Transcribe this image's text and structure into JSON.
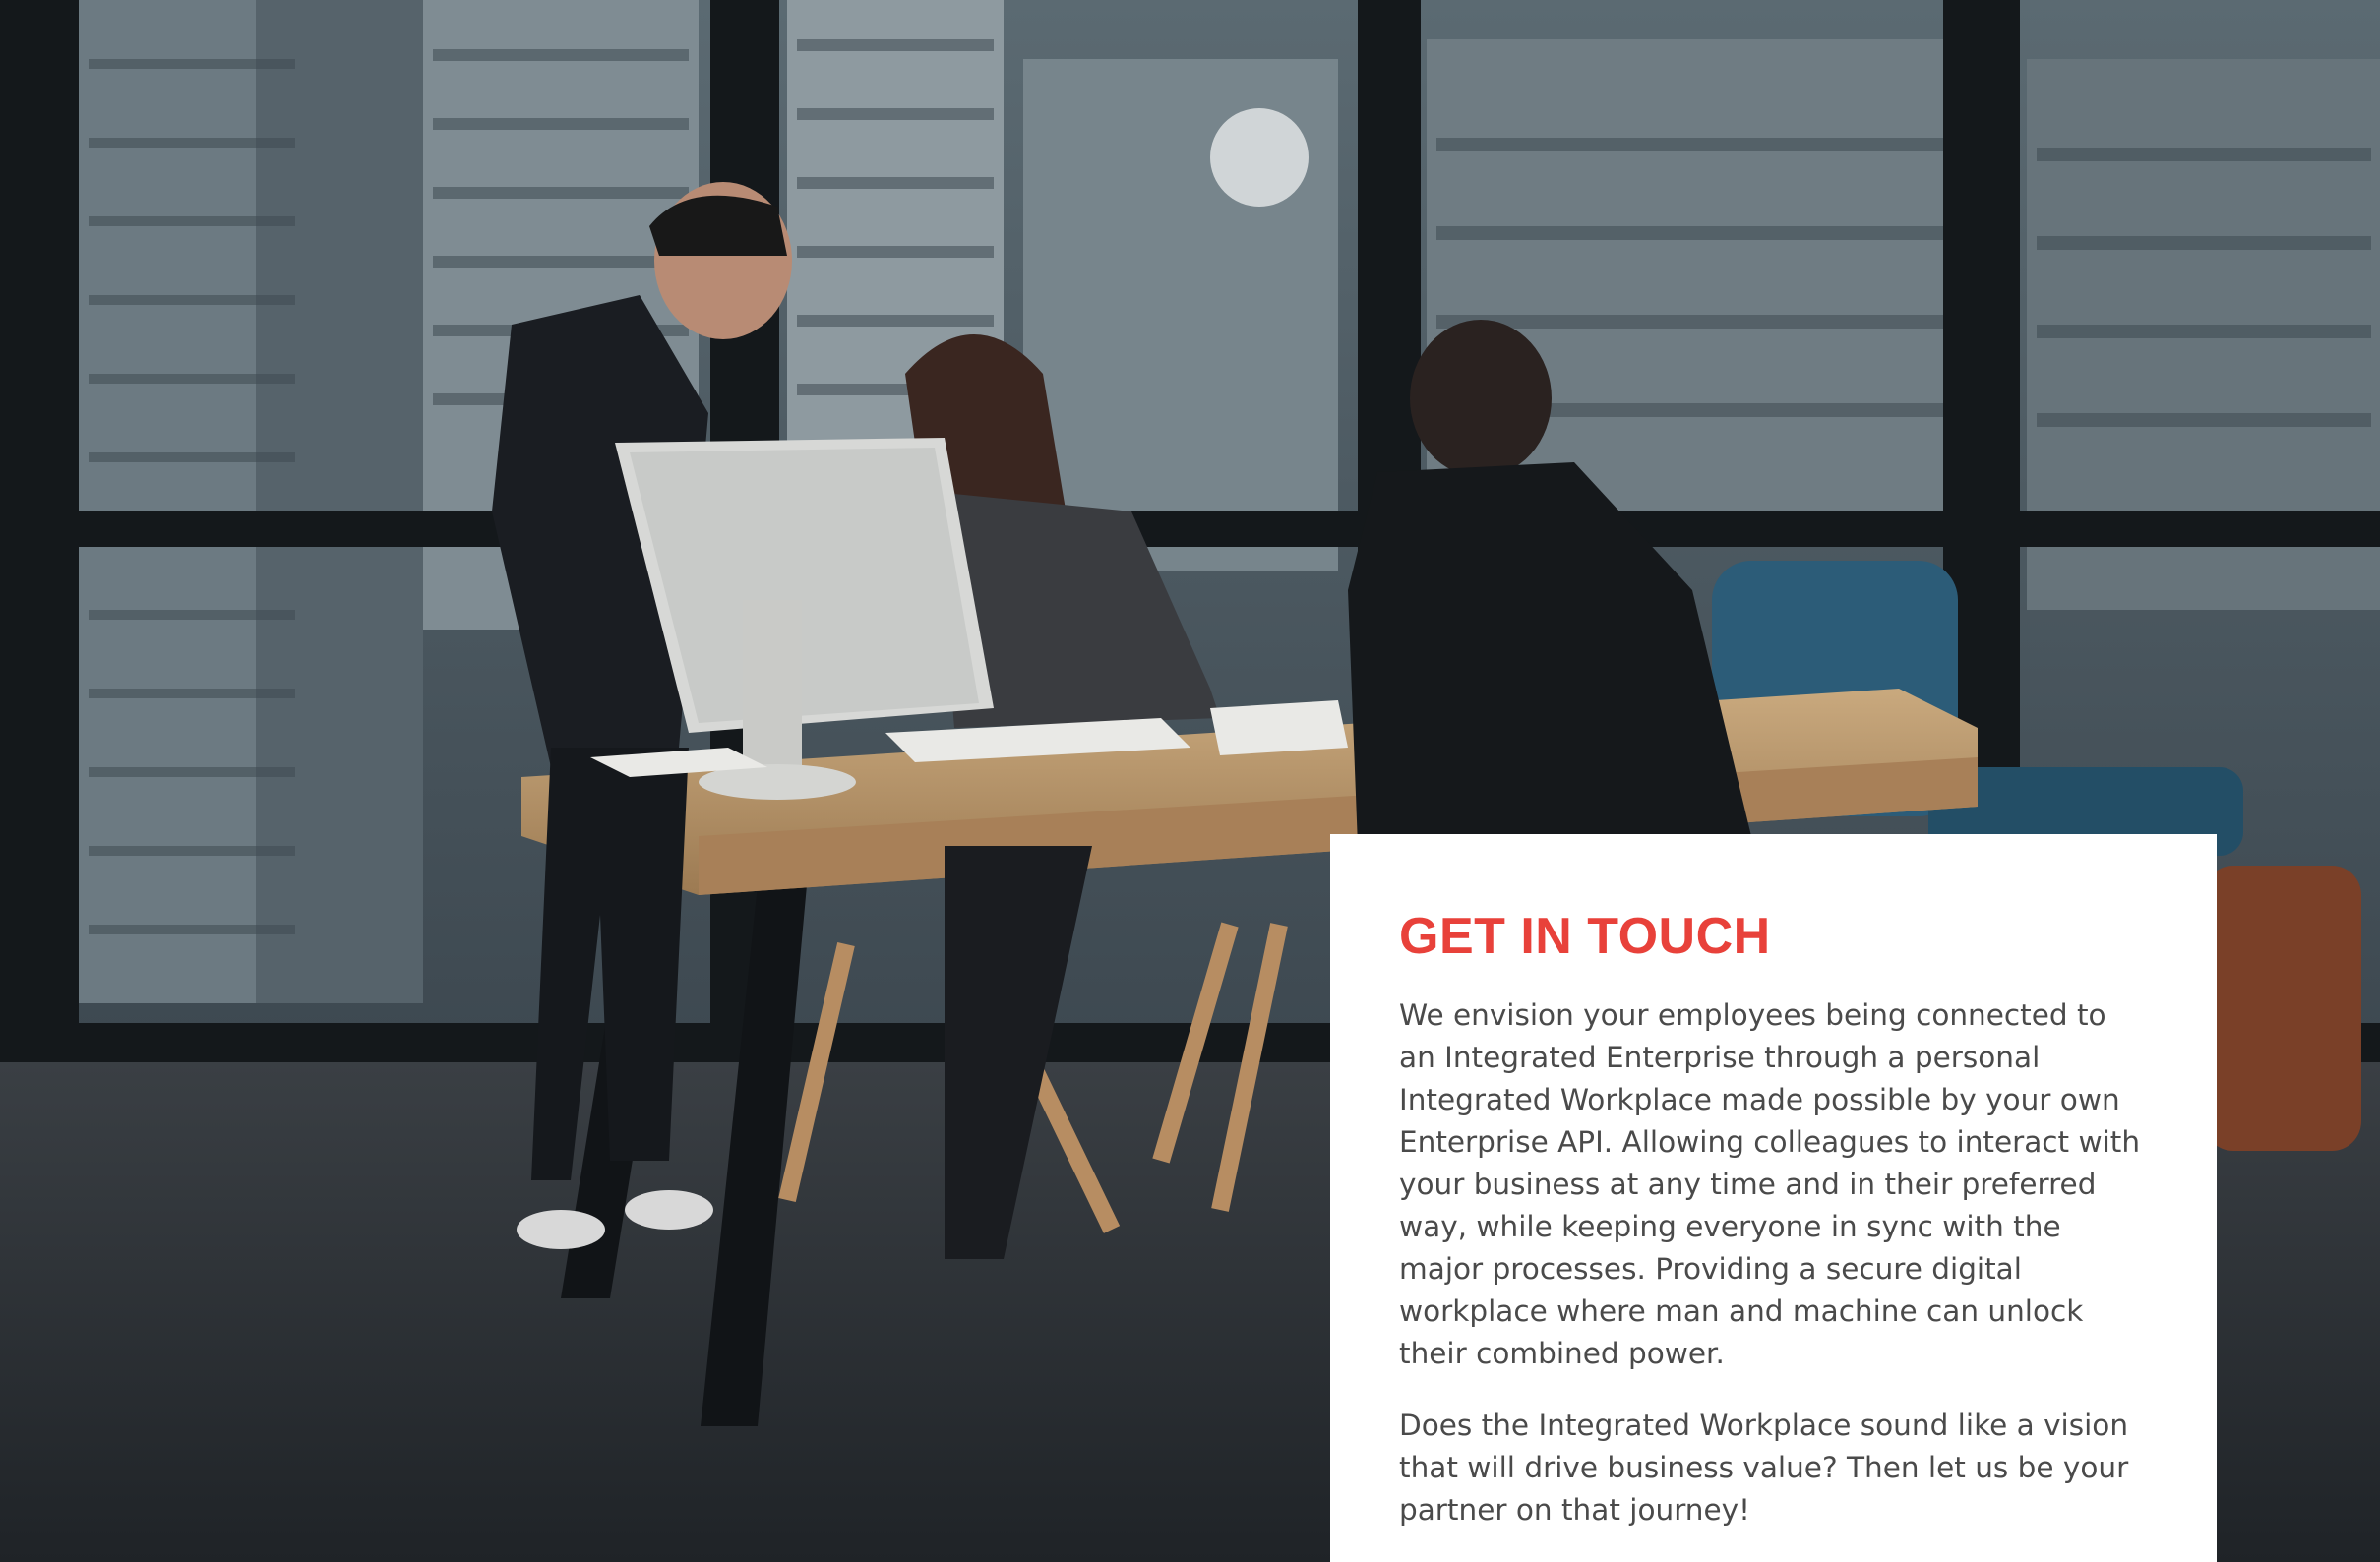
{
  "colors": {
    "accent": "#e8413a",
    "body_text": "#4a4a4a",
    "card_background": "#ffffff"
  },
  "photo": {
    "subject": "office-meeting-photo"
  },
  "card": {
    "title": "GET IN TOUCH",
    "paragraphs": [
      "We envision your employees being connected to an Integrated Enterprise through a personal Integrated Workplace made possible by your own Enterprise API. Allowing colleagues to interact with your business at any time and in their preferred way, while keeping everyone in sync with the major processes. Providing a secure digital workplace where man and machine can unlock their combined power.",
      "Does the Integrated Workplace sound like a vision that will drive business value? Then let us be your partner on that journey!"
    ]
  }
}
